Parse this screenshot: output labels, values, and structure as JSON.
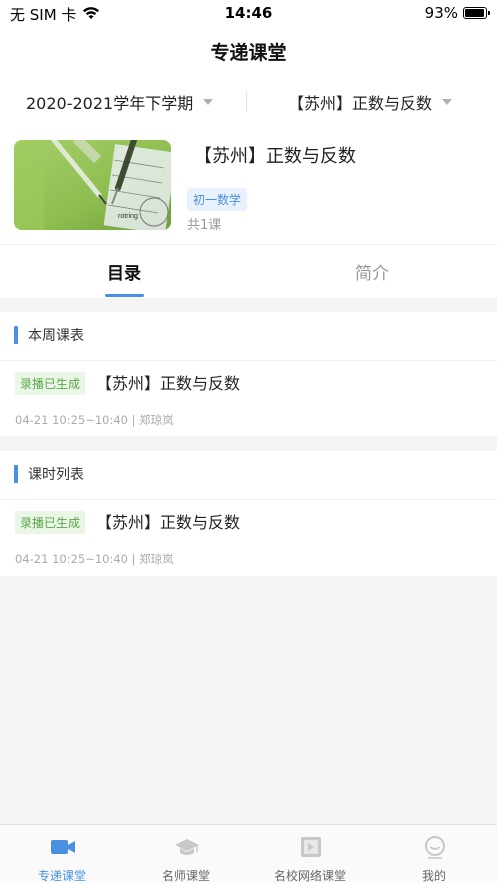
{
  "status_bar": {
    "carrier": "无 SIM 卡",
    "time": "14:46",
    "battery": "93%",
    "battery_level": 0.93
  },
  "nav": {
    "title": "专递课堂"
  },
  "filters": {
    "term": "2020-2021学年下学期",
    "course": "【苏州】正数与反数"
  },
  "course": {
    "title": "【苏州】正数与反数",
    "tag": "初一数学",
    "lesson_count": "共1课",
    "thumbnail_brand": "rotring"
  },
  "tabs": {
    "catalog": "目录",
    "intro": "简介"
  },
  "sections": [
    {
      "title": "本周课表",
      "badge": "录播已生成",
      "lesson_title": "【苏州】正数与反数",
      "meta": "04-21 10:25~10:40 | 郑琼岚"
    },
    {
      "title": "课时列表",
      "badge": "录播已生成",
      "lesson_title": "【苏州】正数与反数",
      "meta": "04-21 10:25~10:40 | 郑琼岚"
    }
  ],
  "tab_bar": {
    "items": [
      {
        "label": "专递课堂",
        "icon": "video-camera-icon",
        "active": true
      },
      {
        "label": "名师课堂",
        "icon": "graduation-cap-icon",
        "active": false
      },
      {
        "label": "名校网络课堂",
        "icon": "video-file-icon",
        "active": false
      },
      {
        "label": "我的",
        "icon": "smile-face-icon",
        "active": false
      }
    ]
  },
  "colors": {
    "accent": "#4a90e2",
    "badge_green": "#5aa64a",
    "tag_blue": "#4a8fe0"
  }
}
